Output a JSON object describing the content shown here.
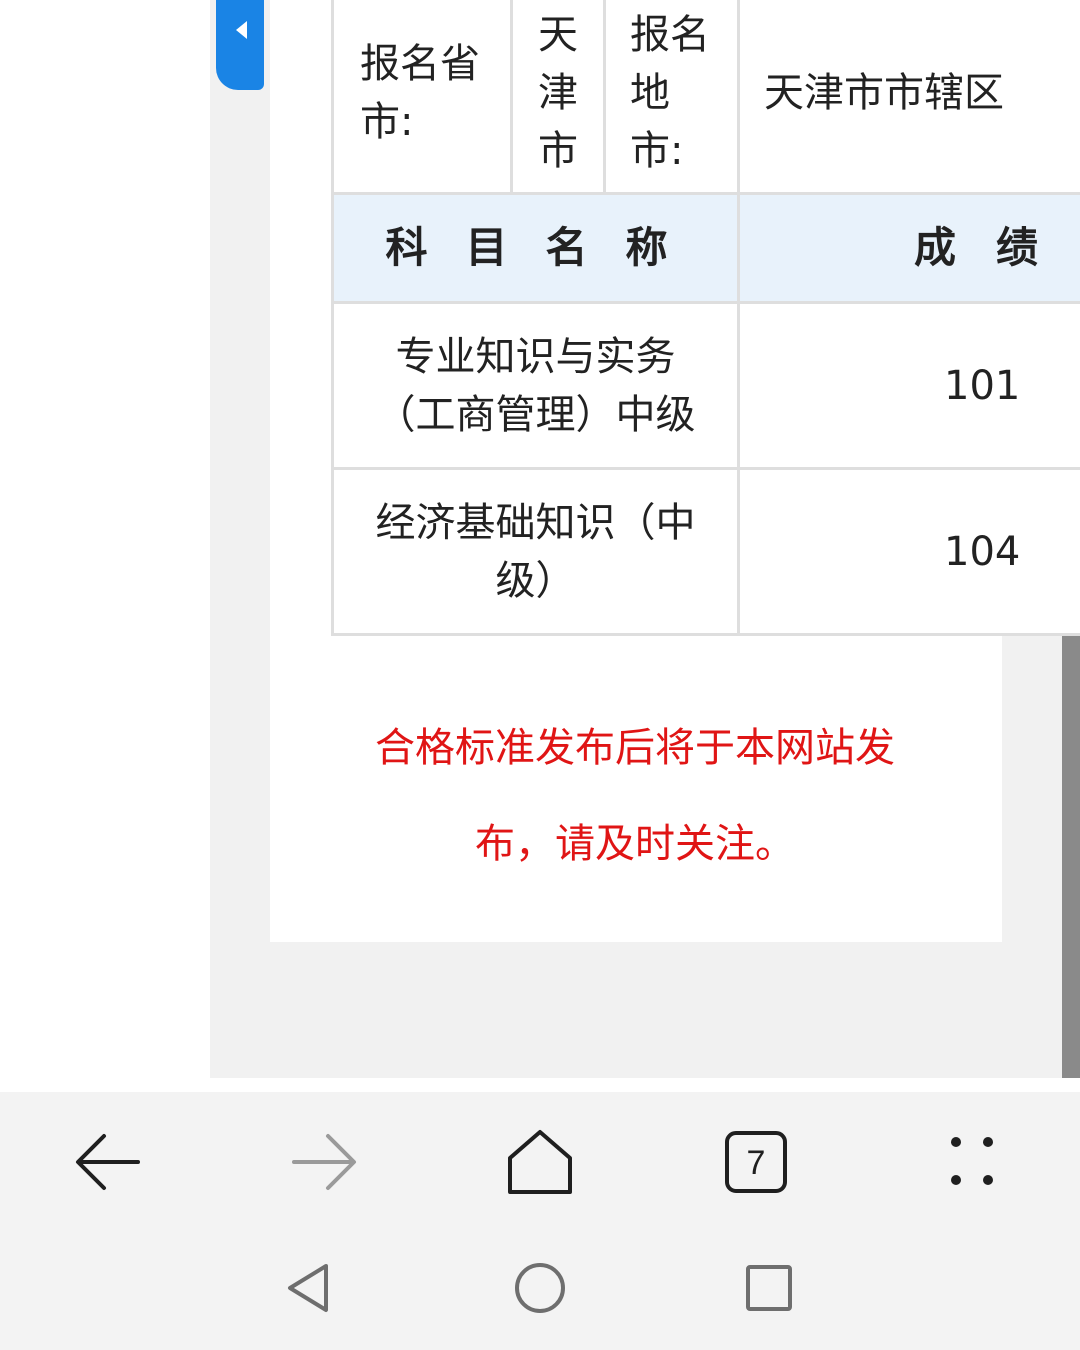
{
  "side_tab": {
    "icon": "caret-left-icon"
  },
  "table": {
    "region_label": "报名省市:",
    "region_province": "天津市",
    "city_label": "报名地市:",
    "city_value": "天津市市辖区",
    "header_subject": "科目名称",
    "header_score": "成绩",
    "rows": [
      {
        "subject": "专业知识与实务（工商管理）中级",
        "score": "101"
      },
      {
        "subject": "经济基础知识（中级）",
        "score": "104"
      }
    ]
  },
  "notice": {
    "line1": "合格标准发布后将于本网站发",
    "line2": "布，请及时关注。",
    "color": "#e01515"
  },
  "browser_bar": {
    "back_icon": "arrow-left-icon",
    "forward_icon": "arrow-right-icon",
    "home_icon": "home-icon",
    "tab_count": "7",
    "menu_icon": "dots-menu-icon"
  },
  "system_nav": {
    "back_icon": "triangle-back-icon",
    "home_icon": "circle-home-icon",
    "recents_icon": "square-recents-icon"
  },
  "colors": {
    "accent_blue": "#1a84e5",
    "header_bg": "#e8f2fb"
  }
}
